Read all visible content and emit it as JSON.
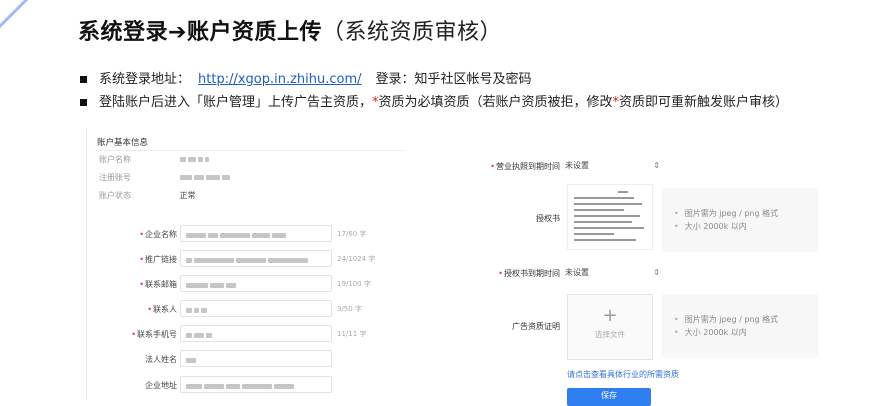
{
  "title": {
    "part1": "系统登录",
    "arrow": "➔",
    "part2": "账户资质上传",
    "part3": "（系统资质审核）"
  },
  "bullets": {
    "line1_label": "系统登录地址：",
    "line1_link": "http://xgop.in.zhihu.com/",
    "line1_login": "登录：知乎社区帐号及密码",
    "line2_a": "登陆账户后进入「账户管理」上传广告主资质，",
    "line2_star": "*",
    "line2_b": "资质为必填资质（若账户资质被拒，修改",
    "line2_star2": "*",
    "line2_c": "资质即可重新触发账户审核）"
  },
  "left_form": {
    "section_title": "账户基本信息",
    "info": [
      {
        "label": "账户名称",
        "value": ""
      },
      {
        "label": "注册账号",
        "value": ""
      },
      {
        "label": "账户状态",
        "value": "正常"
      }
    ],
    "fields": [
      {
        "label": "企业名称",
        "required": true,
        "count": "17/60 字"
      },
      {
        "label": "推广链接",
        "required": true,
        "count": "24/1024 字"
      },
      {
        "label": "联系邮箱",
        "required": true,
        "count": "19/100 字"
      },
      {
        "label": "联系人",
        "required": true,
        "count": "3/50 字"
      },
      {
        "label": "联系手机号",
        "required": true,
        "count": "11/11 字"
      },
      {
        "label": "法人姓名",
        "required": false,
        "count": ""
      },
      {
        "label": "企业地址",
        "required": false,
        "count": ""
      }
    ]
  },
  "right_form": {
    "license_expiry_label": "营业执照到期时间",
    "license_expiry_value": "未设置",
    "auth_label": "授权书",
    "auth_expiry_label": "授权书到期时间",
    "auth_expiry_value": "未设置",
    "ad_cert_label": "广告资质证明",
    "upload_text": "选择文件",
    "hint_line1": "图片需为 jpeg / png 格式",
    "hint_line2": "大小 2000k 以内",
    "industry_link": "请点击查看具体行业的所需资质",
    "save_label": "保存"
  },
  "colors": {
    "accent": "#2f7ff0",
    "link": "#1f5fbf",
    "required": "#e33333"
  }
}
